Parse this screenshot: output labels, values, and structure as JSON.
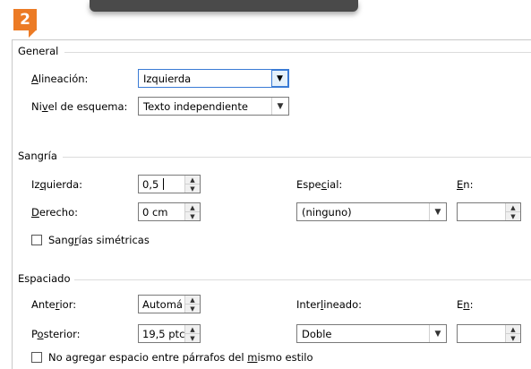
{
  "step_badge": "2",
  "general": {
    "section_title": "General",
    "alignment": {
      "label_pre": "",
      "label_u": "A",
      "label_post": "lineación:",
      "value": "Izquierda"
    },
    "outline_level": {
      "label_pre": "Ni",
      "label_u": "v",
      "label_post": "el de esquema:",
      "value": "Texto independiente"
    }
  },
  "indent": {
    "section_title": "Sangría",
    "left": {
      "label_pre": "Iz",
      "label_u": "q",
      "label_post": "uierda:",
      "value": "0,5"
    },
    "right": {
      "label_pre": "",
      "label_u": "D",
      "label_post": "erecho:",
      "value": "0 cm"
    },
    "special": {
      "label_pre": "Espe",
      "label_u": "c",
      "label_post": "ial:",
      "value": "(ninguno)"
    },
    "by": {
      "label_pre": "",
      "label_u": "E",
      "label_post": "n:",
      "value": ""
    },
    "mirror": {
      "label_pre": "Sang",
      "label_u": "r",
      "label_post": "ías simétricas",
      "checked": false
    }
  },
  "spacing": {
    "section_title": "Espaciado",
    "before": {
      "label_pre": "Ante",
      "label_u": "r",
      "label_post": "ior:",
      "value": "Automá"
    },
    "after": {
      "label_pre": "P",
      "label_u": "o",
      "label_post": "sterior:",
      "value": "19,5 ptc"
    },
    "line_spacing": {
      "label_pre": "Inter",
      "label_u": "l",
      "label_post": "ineado:",
      "value": "Doble"
    },
    "at": {
      "label_pre": "E",
      "label_u": "n",
      "label_post": ":",
      "value": ""
    },
    "no_space": {
      "label_pre": "No agregar espacio entre párrafos del ",
      "label_u": "m",
      "label_post": "ismo estilo",
      "checked": false
    }
  },
  "icons": {
    "dropdown": "chevron-down-icon",
    "spin_up": "spin-up-icon",
    "spin_down": "spin-down-icon"
  }
}
